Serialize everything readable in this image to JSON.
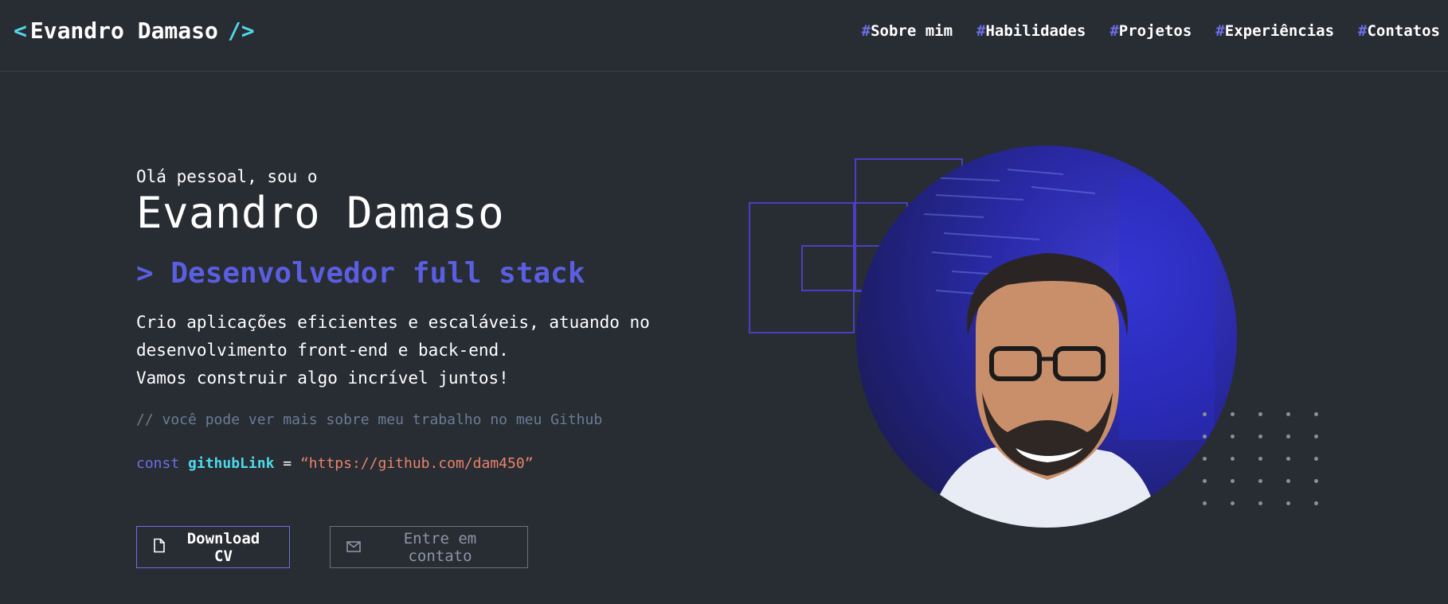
{
  "header": {
    "logo": {
      "open": "<",
      "name": "Evandro Damaso",
      "close": "/>"
    },
    "nav": [
      {
        "hash": "#",
        "label": "Sobre mim"
      },
      {
        "hash": "#",
        "label": "Habilidades"
      },
      {
        "hash": "#",
        "label": "Projetos"
      },
      {
        "hash": "#",
        "label": "Experiências"
      },
      {
        "hash": "#",
        "label": "Contatos"
      }
    ]
  },
  "hero": {
    "greeting": "Olá pessoal, sou o",
    "name": "Evandro Damaso",
    "role": "> Desenvolvedor full stack",
    "description": [
      "Crio aplicações eficientes e escaláveis, atuando no",
      "desenvolvimento front-end e back-end.",
      "Vamos construir algo incrível juntos!"
    ],
    "comment": "// você pode ver mais sobre meu trabalho no meu Github",
    "code": {
      "keyword": "const",
      "variable": "githubLink",
      "equals": "=",
      "value": "“https://github.com/dam450”"
    },
    "buttons": {
      "download": {
        "label": "Download CV",
        "icon": "file-icon"
      },
      "contact": {
        "label": "Entre em contato",
        "icon": "mail-icon"
      }
    }
  },
  "colors": {
    "background": "#282c33",
    "accent_purple": "#6e6ee6",
    "accent_cyan": "#4fd8eb",
    "string": "#e8846b",
    "comment": "#6b7d94"
  }
}
